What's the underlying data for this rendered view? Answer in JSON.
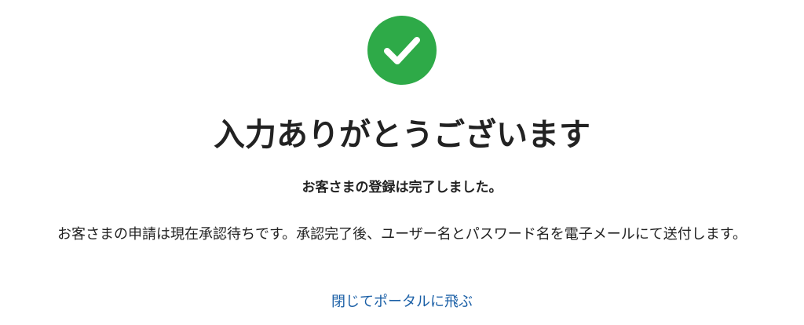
{
  "status_icon": "check-circle-icon",
  "colors": {
    "success": "#2eaa48",
    "text": "#222222",
    "link": "#1a5fa6"
  },
  "title": "入力ありがとうございます",
  "subtitle": "お客さまの登録は完了しました。",
  "message": "お客さまの申請は現在承認待ちです。承認完了後、ユーザー名とパスワード名を電子メールにて送付します。",
  "portal_link_label": "閉じてポータルに飛ぶ"
}
